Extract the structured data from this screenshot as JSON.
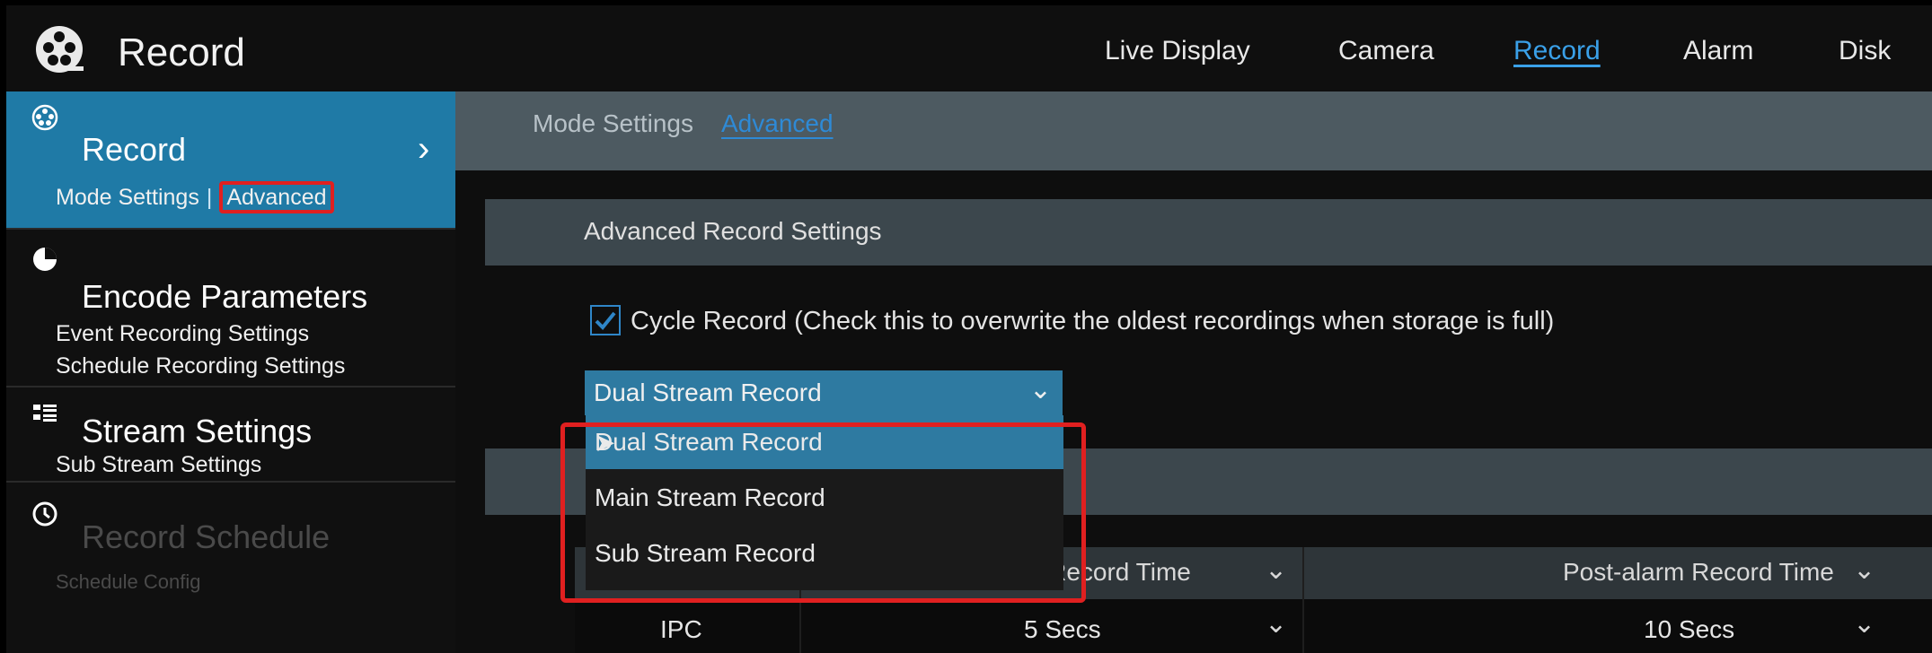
{
  "app": {
    "title": "Record"
  },
  "topnav": [
    "Live Display",
    "Camera",
    "Record",
    "Alarm",
    "Disk"
  ],
  "sidebar": {
    "record": {
      "title": "Record",
      "sub_mode": "Mode Settings",
      "sub_adv": "Advanced"
    },
    "encode": {
      "title": "Encode Parameters",
      "sub1": "Event Recording Settings",
      "sub2": "Schedule Recording Settings"
    },
    "stream": {
      "title": "Stream Settings",
      "sub1": "Sub Stream Settings"
    },
    "schedule": {
      "title": "Record Schedule",
      "sub1": "Schedule Config"
    }
  },
  "subtabs": [
    "Mode Settings",
    "Advanced"
  ],
  "advanced": {
    "section_title": "Advanced Record Settings",
    "cycle_record_label": "Cycle Record (Check this to overwrite the oldest recordings when storage is full)",
    "cycle_record_checked": true,
    "stream_mode_value": "Dual Stream Record",
    "stream_mode_options": [
      "Dual Stream Record",
      "Main Stream Record",
      "Sub Stream Record"
    ]
  },
  "table": {
    "headers": [
      "-alarm Record Time",
      "Post-alarm Record Time"
    ],
    "row": {
      "channel": "IPC",
      "pre": "5 Secs",
      "post": "10 Secs"
    }
  },
  "colors": {
    "accent": "#2e7aa1",
    "link": "#3aa0e8",
    "highlight": "#e02020"
  },
  "icons": [
    "film-reel-icon",
    "pie-chart-icon",
    "grid-list-icon",
    "clock-icon",
    "chevron-right-icon",
    "chevron-down-icon",
    "checkmark-icon",
    "mouse-cursor-icon"
  ]
}
